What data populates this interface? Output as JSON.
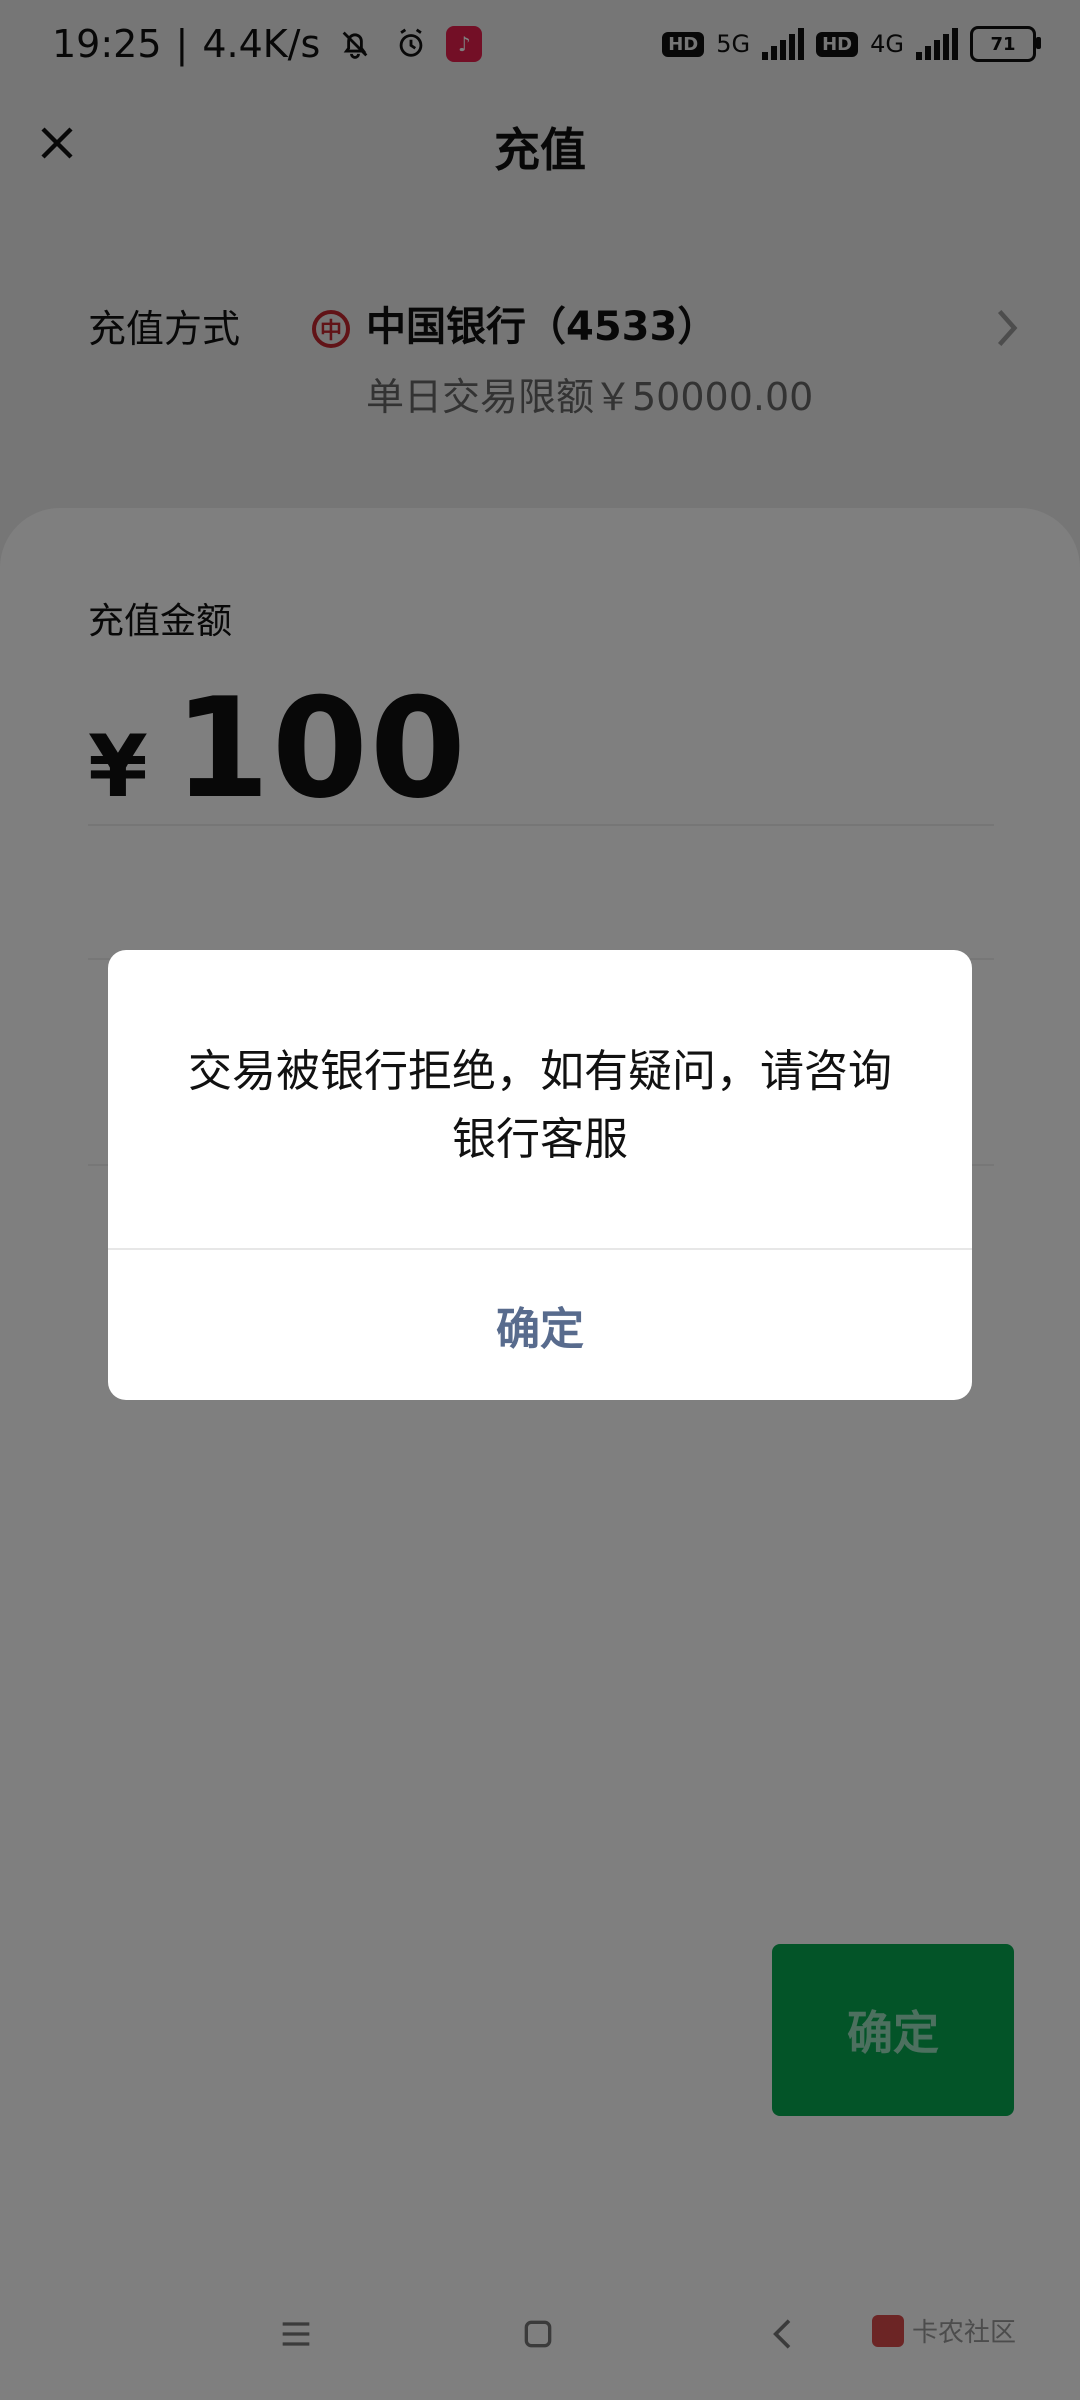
{
  "status_bar": {
    "time": "19:25",
    "network_speed": "4.4K/s",
    "network_5g": "5G",
    "network_4g": "4G",
    "hd_label": "HD",
    "battery": "71"
  },
  "header": {
    "title": "充值"
  },
  "method": {
    "label": "充值方式",
    "bank_name": "中国银行（4533）",
    "limit_text": "单日交易限额￥50000.00"
  },
  "amount": {
    "label": "充值金额",
    "currency": "¥",
    "value": "100"
  },
  "primary_button": {
    "label": "确定"
  },
  "dialog": {
    "message": "交易被银行拒绝，如有疑问，请咨询银行客服",
    "confirm_label": "确定"
  },
  "watermark": {
    "text": "卡农社区"
  },
  "colors": {
    "accent_green": "#07a951",
    "dialog_button": "#586b8d",
    "bank_red": "#c3262e"
  },
  "icons": {
    "close": "close-icon",
    "chevron": "chevron-right-icon",
    "menu": "menu-icon",
    "home": "home-icon",
    "back": "back-icon"
  }
}
